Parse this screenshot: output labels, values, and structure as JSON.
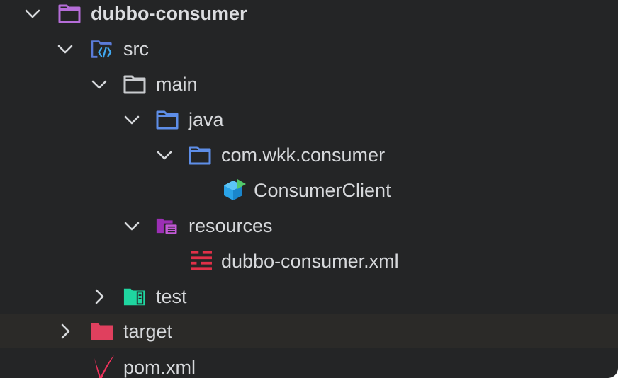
{
  "tree": {
    "rows": [
      {
        "label": "dubbo-consumer",
        "icon": "module-folder-icon",
        "expanded": true
      },
      {
        "label": "src",
        "icon": "source-folder-icon",
        "expanded": true
      },
      {
        "label": "main",
        "icon": "folder-icon",
        "expanded": true
      },
      {
        "label": "java",
        "icon": "java-source-root-icon",
        "expanded": true
      },
      {
        "label": "com.wkk.consumer",
        "icon": "package-icon",
        "expanded": true
      },
      {
        "label": "ConsumerClient",
        "icon": "class-icon"
      },
      {
        "label": "resources",
        "icon": "resources-folder-icon",
        "expanded": true
      },
      {
        "label": "dubbo-consumer.xml",
        "icon": "xml-config-icon"
      },
      {
        "label": "test",
        "icon": "test-folder-icon",
        "expanded": false
      },
      {
        "label": "target",
        "icon": "excluded-folder-icon",
        "expanded": false,
        "selected": true
      },
      {
        "label": "pom.xml",
        "icon": "maven-icon"
      }
    ]
  },
  "colors": {
    "background": "#242526",
    "selected_row": "#2b2a28",
    "text": "#d7d9dc",
    "module_folder": "#b56dd8",
    "source_folder": "#5b7bd8",
    "java_folder": "#5e8ee8",
    "class_icon": "#2aa3e8",
    "resources_folder": "#9c2fb5",
    "xml_icon": "#e03048",
    "test_folder": "#1fd6a0",
    "target_folder": "#e0405e",
    "maven": "#f0325c"
  }
}
